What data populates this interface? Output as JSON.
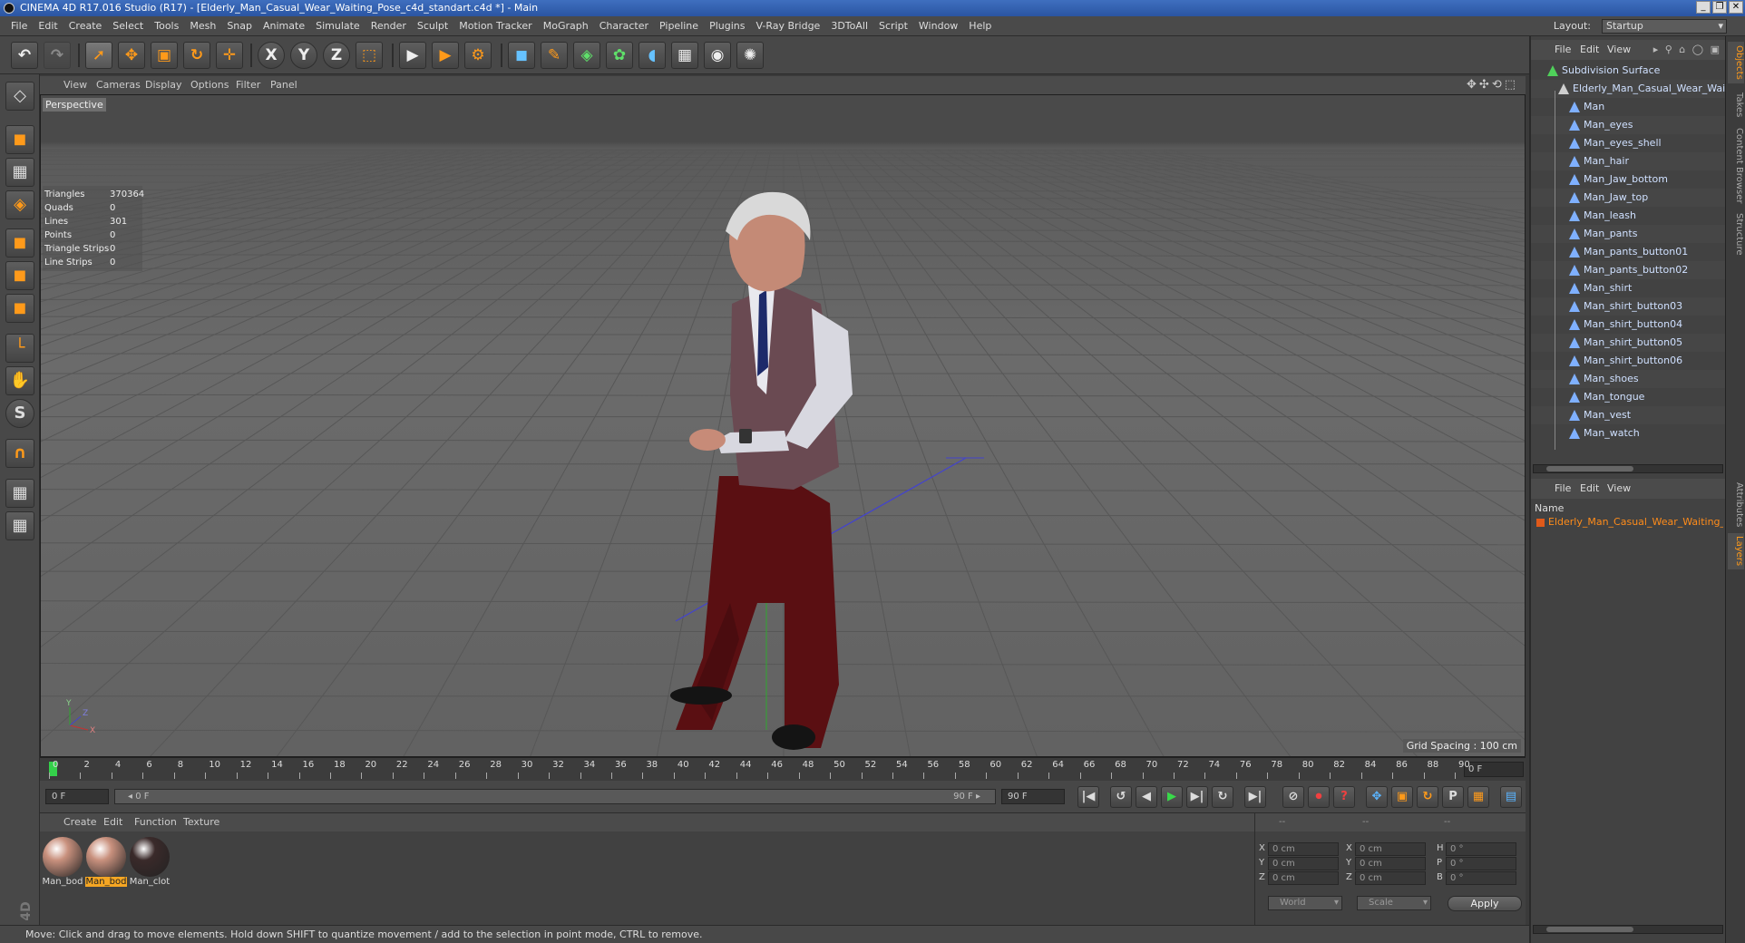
{
  "window": {
    "title": "CINEMA 4D R17.016 Studio (R17) - [Elderly_Man_Casual_Wear_Waiting_Pose_c4d_standart.c4d *] - Main",
    "controls": [
      "_",
      "❐",
      "✕"
    ]
  },
  "menubar": {
    "items": [
      "File",
      "Edit",
      "Create",
      "Select",
      "Tools",
      "Mesh",
      "Snap",
      "Animate",
      "Simulate",
      "Render",
      "Sculpt",
      "Motion Tracker",
      "MoGraph",
      "Character",
      "Pipeline",
      "Plugins",
      "V-Ray Bridge",
      "3DToAll",
      "Script",
      "Window",
      "Help"
    ],
    "layout_label": "Layout:",
    "layout_value": "Startup"
  },
  "toolbar": {
    "undo": "↶",
    "redo": "↷",
    "select": "➚",
    "move": "✥",
    "scale": "▣",
    "rotate": "↻",
    "transform": "✛",
    "axis_x": "X",
    "axis_y": "Y",
    "axis_z": "Z",
    "coord": "⬚",
    "render_view": "▶",
    "render_pv": "▶",
    "render_settings": "⚙",
    "cube": "◼",
    "pen": "✎",
    "subdiv": "◈",
    "array": "✿",
    "deformer": "◖",
    "floor": "▦",
    "camera": "◉",
    "light": "✺"
  },
  "lefttools": {
    "icons": [
      "◇",
      "◼",
      "▦",
      "◈",
      "◼",
      "◼",
      "◼",
      "└",
      "✋",
      "S",
      "∩",
      "▦",
      "▦"
    ]
  },
  "viewport": {
    "menu": [
      "View",
      "Cameras",
      "Display",
      "Options",
      "Filter",
      "Panel"
    ],
    "nav_icons": "✥✣⟲⬚",
    "label": "Perspective",
    "stats": [
      {
        "label": "Triangles",
        "value": "370364"
      },
      {
        "label": "Quads",
        "value": "0"
      },
      {
        "label": "Lines",
        "value": "301"
      },
      {
        "label": "Points",
        "value": "0"
      },
      {
        "label": "Triangle Strips",
        "value": "0"
      },
      {
        "label": "Line Strips",
        "value": "0"
      }
    ],
    "grid_spacing": "Grid Spacing : 100 cm",
    "axis_y": "Y",
    "axis_x": "X",
    "axis_z": "Z"
  },
  "timeline": {
    "ticks": [
      "0",
      "2",
      "4",
      "6",
      "8",
      "10",
      "12",
      "14",
      "16",
      "18",
      "20",
      "22",
      "24",
      "26",
      "28",
      "30",
      "32",
      "34",
      "36",
      "38",
      "40",
      "42",
      "44",
      "46",
      "48",
      "50",
      "52",
      "54",
      "56",
      "58",
      "60",
      "62",
      "64",
      "66",
      "68",
      "70",
      "72",
      "74",
      "76",
      "78",
      "80",
      "82",
      "84",
      "86",
      "88",
      "90"
    ],
    "current_frame": "0 F"
  },
  "transport": {
    "start_frame": "0 F",
    "slider_start": "◂ 0 F",
    "slider_end": "90 F ▸",
    "end_frame": "90 F",
    "buttons": [
      "|◀",
      "↺",
      "◀",
      "▶",
      "▶|",
      "↻",
      "▶|"
    ],
    "key_buttons": [
      "⊘",
      "⏺",
      "?",
      "✥",
      "▣",
      "↻",
      "P",
      "▦",
      "▤"
    ]
  },
  "materials": {
    "menu": [
      "Create",
      "Edit",
      "Function",
      "Texture"
    ],
    "items": [
      {
        "name": "Man_bod",
        "color": "#c9917e"
      },
      {
        "name": "Man_bod",
        "color": "#c9917e",
        "selected": true
      },
      {
        "name": "Man_clot",
        "color": "#3a2a2a"
      }
    ]
  },
  "coords": {
    "header": [
      "--",
      "--",
      "--"
    ],
    "rows": [
      {
        "axis": "X",
        "pos": "0 cm",
        "size_axis": "X",
        "size": "0 cm",
        "rot_axis": "H",
        "rot": "0 °"
      },
      {
        "axis": "Y",
        "pos": "0 cm",
        "size_axis": "Y",
        "size": "0 cm",
        "rot_axis": "P",
        "rot": "0 °"
      },
      {
        "axis": "Z",
        "pos": "0 cm",
        "size_axis": "Z",
        "size": "0 cm",
        "rot_axis": "B",
        "rot": "0 °"
      }
    ],
    "mode": "World",
    "scale_mode": "Scale",
    "apply": "Apply"
  },
  "status": {
    "text": "Move: Click and drag to move elements. Hold down SHIFT to quantize movement / add to the selection in point mode, CTRL to remove."
  },
  "objects": {
    "menu": [
      "File",
      "Edit",
      "View"
    ],
    "icons": "▸ ⚲ ⌂ ◯ ▣",
    "root": "Subdivision Surface",
    "group": "Elderly_Man_Casual_Wear_Waiting",
    "children": [
      "Man",
      "Man_eyes",
      "Man_eyes_shell",
      "Man_hair",
      "Man_Jaw_bottom",
      "Man_Jaw_top",
      "Man_leash",
      "Man_pants",
      "Man_pants_button01",
      "Man_pants_button02",
      "Man_shirt",
      "Man_shirt_button03",
      "Man_shirt_button04",
      "Man_shirt_button05",
      "Man_shirt_button06",
      "Man_shoes",
      "Man_tongue",
      "Man_vest",
      "Man_watch"
    ]
  },
  "layers": {
    "menu": [
      "File",
      "Edit",
      "View"
    ],
    "name_header": "Name",
    "item": "Elderly_Man_Casual_Wear_Waiting_"
  },
  "sidetabs": {
    "top": [
      "Objects",
      "Takes",
      "Content Browser",
      "Structure"
    ],
    "bottom": [
      "Attributes",
      "Layers"
    ]
  },
  "colors": {
    "accent": "#ff9a1a",
    "object_text": "#cfe0ff",
    "layer_text": "#ff8c1a",
    "playhead": "#34d14a"
  }
}
